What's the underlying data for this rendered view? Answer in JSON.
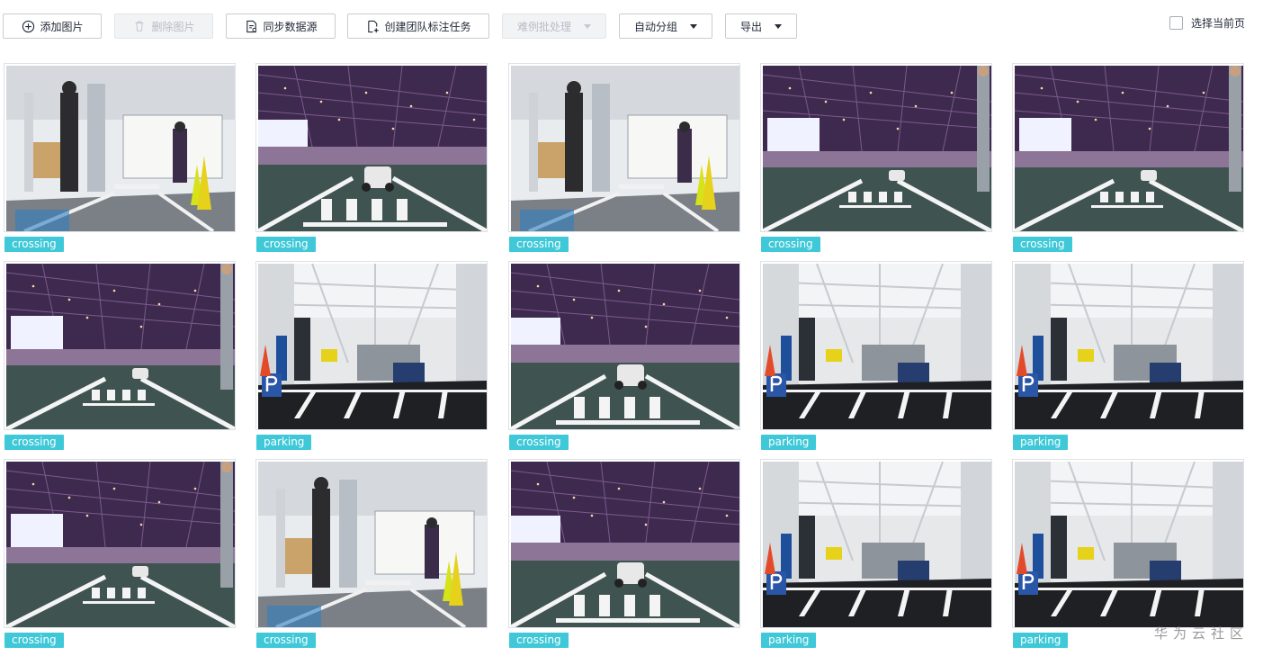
{
  "toolbar": {
    "add_image": "添加图片",
    "delete_image": "删除图片",
    "sync_data_source": "同步数据源",
    "create_team_task": "创建团队标注任务",
    "hard_case_batch": "难例批处理",
    "auto_group": "自动分组",
    "export": "导出",
    "select_current_page": "选择当前页"
  },
  "images": [
    {
      "label": "crossing",
      "scene": "hall"
    },
    {
      "label": "crossing",
      "scene": "arena-car-near"
    },
    {
      "label": "crossing",
      "scene": "hall"
    },
    {
      "label": "crossing",
      "scene": "arena-car-far"
    },
    {
      "label": "crossing",
      "scene": "arena-car-far"
    },
    {
      "label": "crossing",
      "scene": "arena-car-far"
    },
    {
      "label": "parking",
      "scene": "lab-parking"
    },
    {
      "label": "crossing",
      "scene": "arena-car-near"
    },
    {
      "label": "parking",
      "scene": "lab-parking"
    },
    {
      "label": "parking",
      "scene": "lab-parking"
    },
    {
      "label": "crossing",
      "scene": "arena-car-far"
    },
    {
      "label": "crossing",
      "scene": "hall"
    },
    {
      "label": "crossing",
      "scene": "arena-car-near"
    },
    {
      "label": "parking",
      "scene": "lab-parking"
    },
    {
      "label": "parking",
      "scene": "lab-parking"
    }
  ],
  "watermark": "华为云社区",
  "colors": {
    "tag": "#3ec8d8",
    "border": "#c9ccd2"
  }
}
